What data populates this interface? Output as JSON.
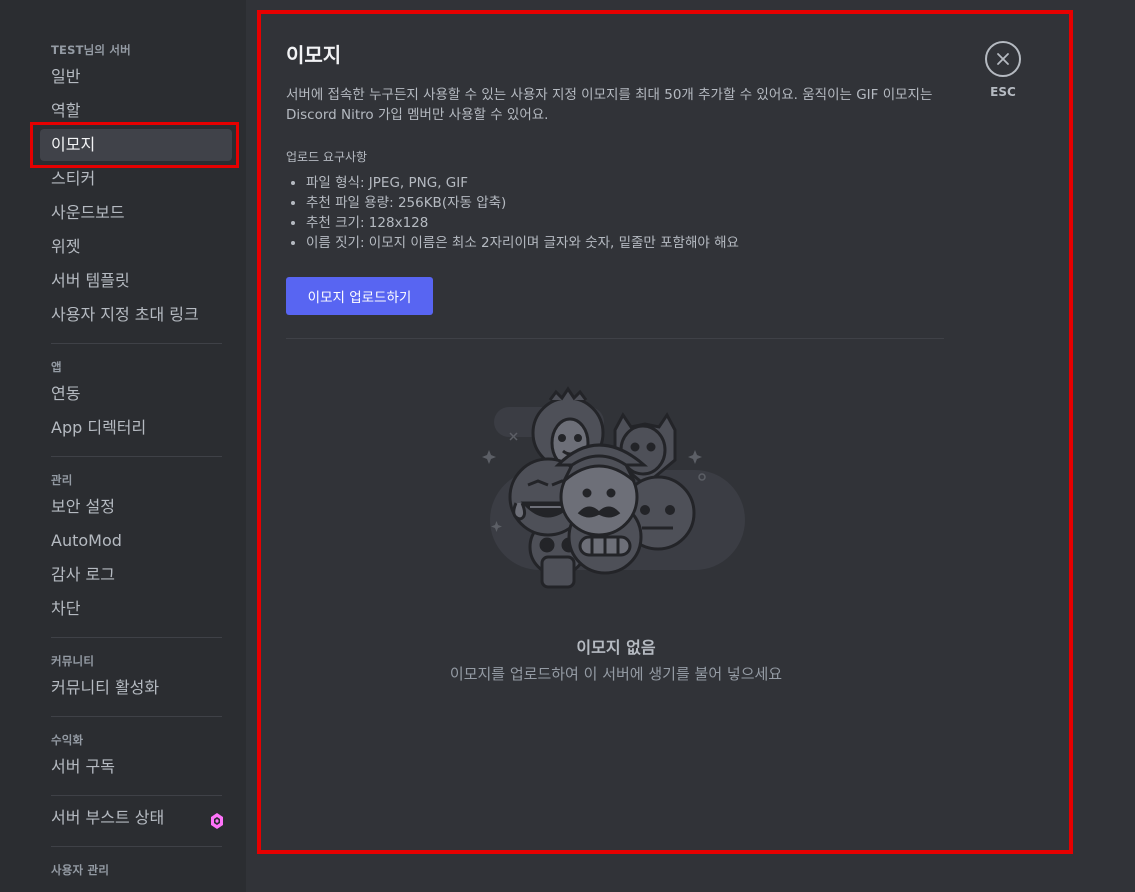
{
  "sidebar": {
    "server_section": "TEST님의 서버",
    "items_server": [
      "일반",
      "역할",
      "이모지",
      "스티커",
      "사운드보드",
      "위젯",
      "서버 템플릿",
      "사용자 지정 초대 링크"
    ],
    "app_section": "앱",
    "items_app": [
      "연동",
      "App 디렉터리"
    ],
    "manage_section": "관리",
    "items_manage": [
      "보안 설정",
      "AutoMod",
      "감사 로그",
      "차단"
    ],
    "community_section": "커뮤니티",
    "items_community": [
      "커뮤니티 활성화"
    ],
    "monetize_section": "수익화",
    "items_monetize": [
      "서버 구독"
    ],
    "boost_label": "서버 부스트 상태",
    "user_section": "사용자 관리"
  },
  "main": {
    "title": "이모지",
    "description": "서버에 접속한 누구든지 사용할 수 있는 사용자 지정 이모지를 최대 50개 추가할 수 있어요. 움직이는 GIF 이모지는 Discord Nitro 가입 멤버만 사용할 수 있어요.",
    "requirements_title": "업로드 요구사항",
    "requirements": [
      "파일 형식: JPEG, PNG, GIF",
      "추천 파일 용량: 256KB(자동 압축)",
      "추천 크기: 128x128",
      "이름 짓기: 이모지 이름은 최소 2자리이며 글자와 숫자, 밑줄만 포함해야 해요"
    ],
    "upload_button": "이모지 업로드하기",
    "close_label": "ESC",
    "empty_title": "이모지 없음",
    "empty_subtitle": "이모지를 업로드하여 이 서버에 생기를 불어 넣으세요"
  },
  "colors": {
    "accent": "#5865f2",
    "highlight_box": "#e60000",
    "boost": "#ff73fa"
  },
  "icons": [
    "close-icon",
    "boost-gem-icon",
    "emoji-faces-illustration"
  ]
}
